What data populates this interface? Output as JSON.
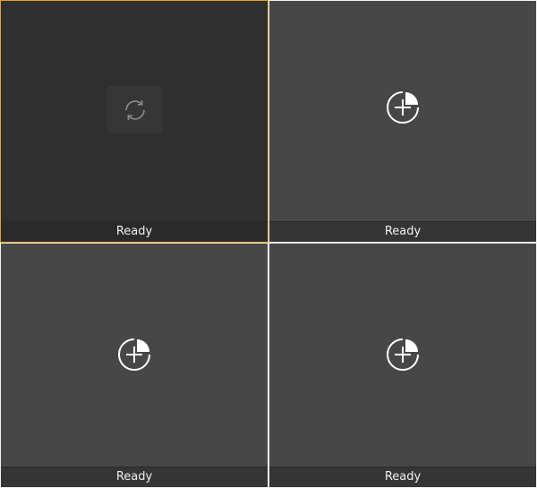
{
  "panes": [
    {
      "status": "Ready",
      "state": "loading",
      "icon": "refresh-icon",
      "selected": true
    },
    {
      "status": "Ready",
      "state": "empty",
      "icon": "add-video-icon"
    },
    {
      "status": "Ready",
      "state": "empty",
      "icon": "add-video-icon"
    },
    {
      "status": "Ready",
      "state": "empty",
      "icon": "add-video-icon"
    }
  ],
  "colors": {
    "selected_border": "#e8a317",
    "grid_line": "#f2f2f2",
    "pane_background": "#474747",
    "selected_pane_background": "#2f2f2f"
  }
}
